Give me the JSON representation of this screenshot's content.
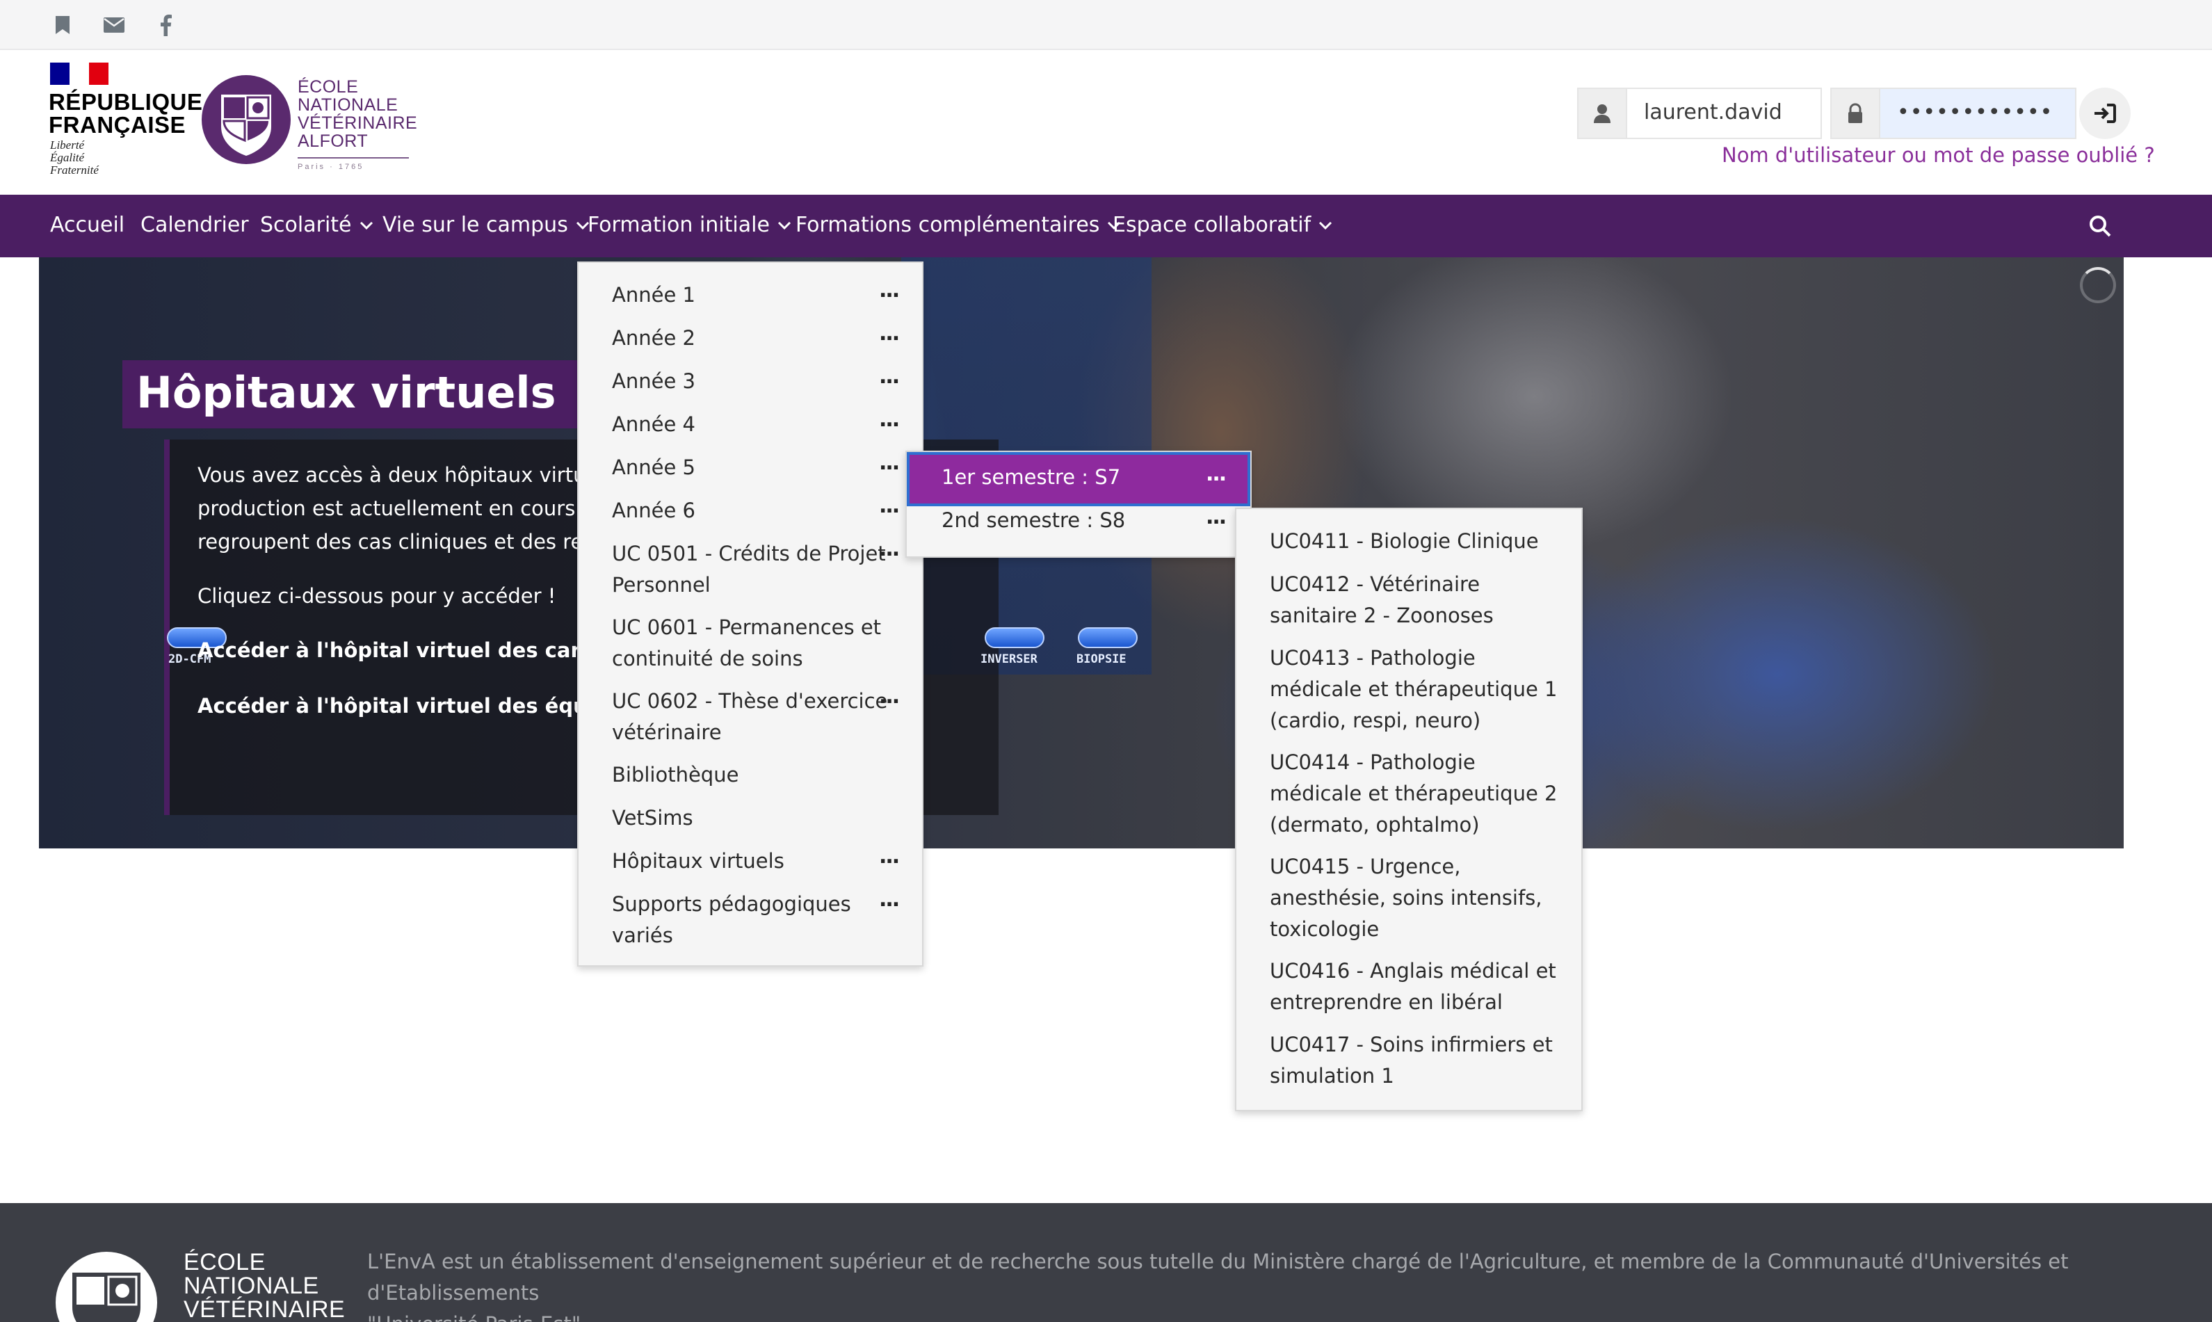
{
  "topbar": {
    "icons": [
      "bookmark-icon",
      "mail-icon",
      "facebook-icon"
    ]
  },
  "header": {
    "republique": {
      "line1": "RÉPUBLIQUE",
      "line2": "FRANÇAISE",
      "motto1": "Liberté",
      "motto2": "Égalité",
      "motto3": "Fraternité"
    },
    "school": {
      "line1": "ÉCOLE",
      "line2": "NATIONALE",
      "line3": "VÉTÉRINAIRE",
      "line4": "ALFORT",
      "sub": "Paris · 1765"
    },
    "login": {
      "username": "laurent.david",
      "password": "••••••••••••",
      "forgot": "Nom d'utilisateur ou mot de passe oublié ?"
    }
  },
  "nav": {
    "items": [
      {
        "label": "Accueil"
      },
      {
        "label": "Calendrier"
      },
      {
        "label": "Scolarité"
      },
      {
        "label": "Vie sur le campus"
      },
      {
        "label": "Formation initiale"
      },
      {
        "label": "Formations complémentaires"
      },
      {
        "label": "Espace collaboratif"
      }
    ]
  },
  "hero": {
    "title": "Hôpitaux virtuels",
    "p1": "Vous avez accès à deux hôpitaux virtuels",
    "p2": "production est actuellement en cours de",
    "p3": "regroupent des cas cliniques et des ress",
    "p4": "Cliquez ci-dessous pour y accéder !",
    "link1": "Accéder à l'hôpital virtuel des carnivor",
    "link2": "Accéder à l'hôpital virtuel des équidés",
    "screen_buttons": [
      "2D-CFM",
      "INVERSER",
      "BIOPSIE"
    ]
  },
  "menu1": {
    "items": [
      {
        "l1": "Année 1",
        "l2": ""
      },
      {
        "l1": "Année 2",
        "l2": ""
      },
      {
        "l1": "Année 3",
        "l2": ""
      },
      {
        "l1": "Année 4",
        "l2": ""
      },
      {
        "l1": "Année 5",
        "l2": ""
      },
      {
        "l1": "Année 6",
        "l2": ""
      },
      {
        "l1": "UC 0501 - Crédits de Projet",
        "l2": "Personnel"
      },
      {
        "l1": "UC 0601 - Permanences et",
        "l2": "continuité de soins"
      },
      {
        "l1": "UC 0602 - Thèse d'exercice",
        "l2": "vétérinaire"
      },
      {
        "l1": "Bibliothèque",
        "l2": ""
      },
      {
        "l1": "VetSims",
        "l2": ""
      },
      {
        "l1": "Hôpitaux virtuels",
        "l2": ""
      },
      {
        "l1": "Supports pédagogiques",
        "l2": "variés"
      }
    ],
    "dots": "..."
  },
  "menu2": {
    "items": [
      {
        "label": "1er semestre : S7"
      },
      {
        "label": "2nd semestre : S8"
      }
    ]
  },
  "menu3": {
    "items": [
      {
        "l1": "UC0411 - Biologie Clinique",
        "l2": "",
        "l3": ""
      },
      {
        "l1": "UC0412 - Vétérinaire",
        "l2": "sanitaire 2 - Zoonoses",
        "l3": ""
      },
      {
        "l1": "UC0413 - Pathologie",
        "l2": "médicale et thérapeutique 1",
        "l3": "(cardio, respi, neuro)"
      },
      {
        "l1": "UC0414 - Pathologie",
        "l2": "médicale et thérapeutique 2",
        "l3": "(dermato, ophtalmo)"
      },
      {
        "l1": "UC0415 - Urgence,",
        "l2": "anesthésie, soins intensifs,",
        "l3": "toxicologie"
      },
      {
        "l1": "UC0416 - Anglais médical et",
        "l2": "entreprendre en libéral",
        "l3": ""
      },
      {
        "l1": "UC0417 - Soins infirmiers et",
        "l2": "simulation 1",
        "l3": ""
      }
    ]
  },
  "footer": {
    "name1": "ÉCOLE",
    "name2": "NATIONALE",
    "name3": "VÉTÉRINAIRE",
    "text1": "L'EnvA est un établissement d'enseignement supérieur et de recherche sous tutelle du Ministère chargé de l'Agriculture, et membre de la Communauté d'Universités et d'Etablissements",
    "text2": "\"Université Paris-Est\"."
  },
  "colors": {
    "primary": "#4b1e62",
    "accent": "#8e2a9e",
    "link": "#8a2f9a",
    "footer": "#3c3e45"
  }
}
